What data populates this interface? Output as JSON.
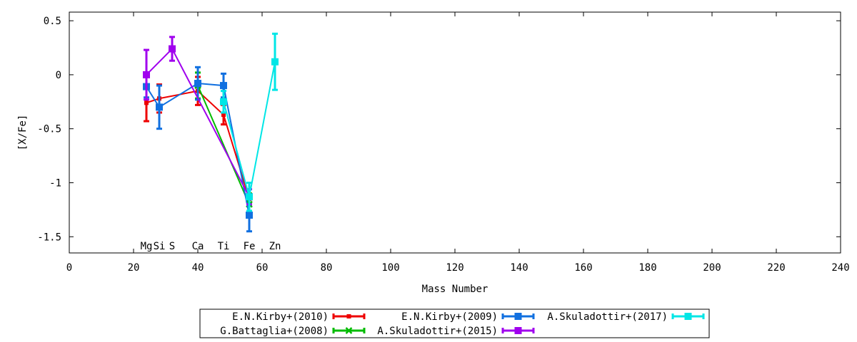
{
  "chart_data": {
    "type": "line",
    "xlabel": "Mass Number",
    "ylabel": "[X/Fe]",
    "xlim": [
      0,
      240
    ],
    "ylim": [
      -1.65,
      0.58
    ],
    "xticks": [
      0,
      20,
      40,
      60,
      80,
      100,
      120,
      140,
      160,
      180,
      200,
      220,
      240
    ],
    "yticks": [
      {
        "value": 0.5,
        "label": "0.5"
      },
      {
        "value": 0,
        "label": "0"
      },
      {
        "value": -0.5,
        "label": "-0.5"
      },
      {
        "value": -1,
        "label": "-1"
      },
      {
        "value": -1.5,
        "label": "-1.5"
      }
    ],
    "element_labels": [
      {
        "x": 24,
        "text": "Mg"
      },
      {
        "x": 28,
        "text": "Si"
      },
      {
        "x": 32,
        "text": "S"
      },
      {
        "x": 40,
        "text": "Ca"
      },
      {
        "x": 48,
        "text": "Ti"
      },
      {
        "x": 56,
        "text": "Fe"
      },
      {
        "x": 64,
        "text": "Zn"
      }
    ],
    "legend_position": "bottom-center",
    "grid": false,
    "series": [
      {
        "name": "E.N.Kirby+(2010)",
        "color": "#ee0000",
        "marker": "bar",
        "points": [
          {
            "x": 24,
            "y": -0.26,
            "err": 0.17
          },
          {
            "x": 28,
            "y": -0.22,
            "err": 0.13
          },
          {
            "x": 40,
            "y": -0.15,
            "err": 0.13
          },
          {
            "x": 48,
            "y": -0.37,
            "err": 0.09
          },
          {
            "x": 56,
            "y": -1.15,
            "err": 0.05
          }
        ]
      },
      {
        "name": "G.Battaglia+(2008)",
        "color": "#00bb00",
        "marker": "x",
        "points": [
          {
            "x": 40,
            "y": -0.1,
            "err": 0.12
          },
          {
            "x": 56,
            "y": -1.2,
            "err": 0.1
          }
        ]
      },
      {
        "name": "E.N.Kirby+(2009)",
        "color": "#1170e0",
        "marker": "square",
        "points": [
          {
            "x": 24,
            "y": -0.11,
            "err": 0.1
          },
          {
            "x": 28,
            "y": -0.3,
            "err": 0.2
          },
          {
            "x": 40,
            "y": -0.08,
            "err": 0.15
          },
          {
            "x": 48,
            "y": -0.1,
            "err": 0.11
          },
          {
            "x": 56,
            "y": -1.3,
            "err": 0.15
          }
        ]
      },
      {
        "name": "A.Skuladottir+(2015)",
        "color": "#a000ee",
        "marker": "square",
        "points": [
          {
            "x": 24,
            "y": 0.0,
            "err": 0.23
          },
          {
            "x": 32,
            "y": 0.24,
            "err": 0.11
          },
          {
            "x": 56,
            "y": -1.13,
            "err": 0.07
          }
        ]
      },
      {
        "name": "A.Skuladottir+(2017)",
        "color": "#00e6e6",
        "marker": "square",
        "points": [
          {
            "x": 48,
            "y": -0.25,
            "err": 0.1
          },
          {
            "x": 56,
            "y": -1.13,
            "err": 0.13
          },
          {
            "x": 64,
            "y": 0.12,
            "err": 0.26
          }
        ]
      }
    ]
  }
}
